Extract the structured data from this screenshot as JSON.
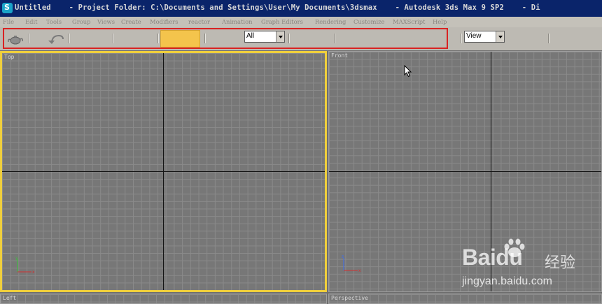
{
  "window": {
    "title": "Untitled    - Project Folder: C:\\Documents and Settings\\User\\My Documents\\3dsmax    - Autodesk 3ds Max 9 SP2    - Di"
  },
  "menu": {
    "items": [
      "File",
      "Edit",
      "Tools",
      "Group",
      "Views",
      "Create",
      "Modifiers",
      "reactor",
      "Animation",
      "Graph Editors",
      "Rendering",
      "Customize",
      "MAXScript",
      "Help"
    ]
  },
  "toolbar": {
    "selection_filter": "All",
    "reference_coord": "View",
    "highlight_color": "#d92222",
    "selection_field_color": "#f4c44c"
  },
  "viewports": {
    "top": "Top",
    "front": "Front",
    "left": "Left",
    "perspective": "Perspective",
    "active_border_color": "#f0cf3c"
  },
  "gizmo": {
    "x": "x",
    "y": "y",
    "z": "z"
  },
  "watermark": {
    "brand": "Baidu",
    "cn": "经验",
    "url": "jingyan.baidu.com"
  }
}
